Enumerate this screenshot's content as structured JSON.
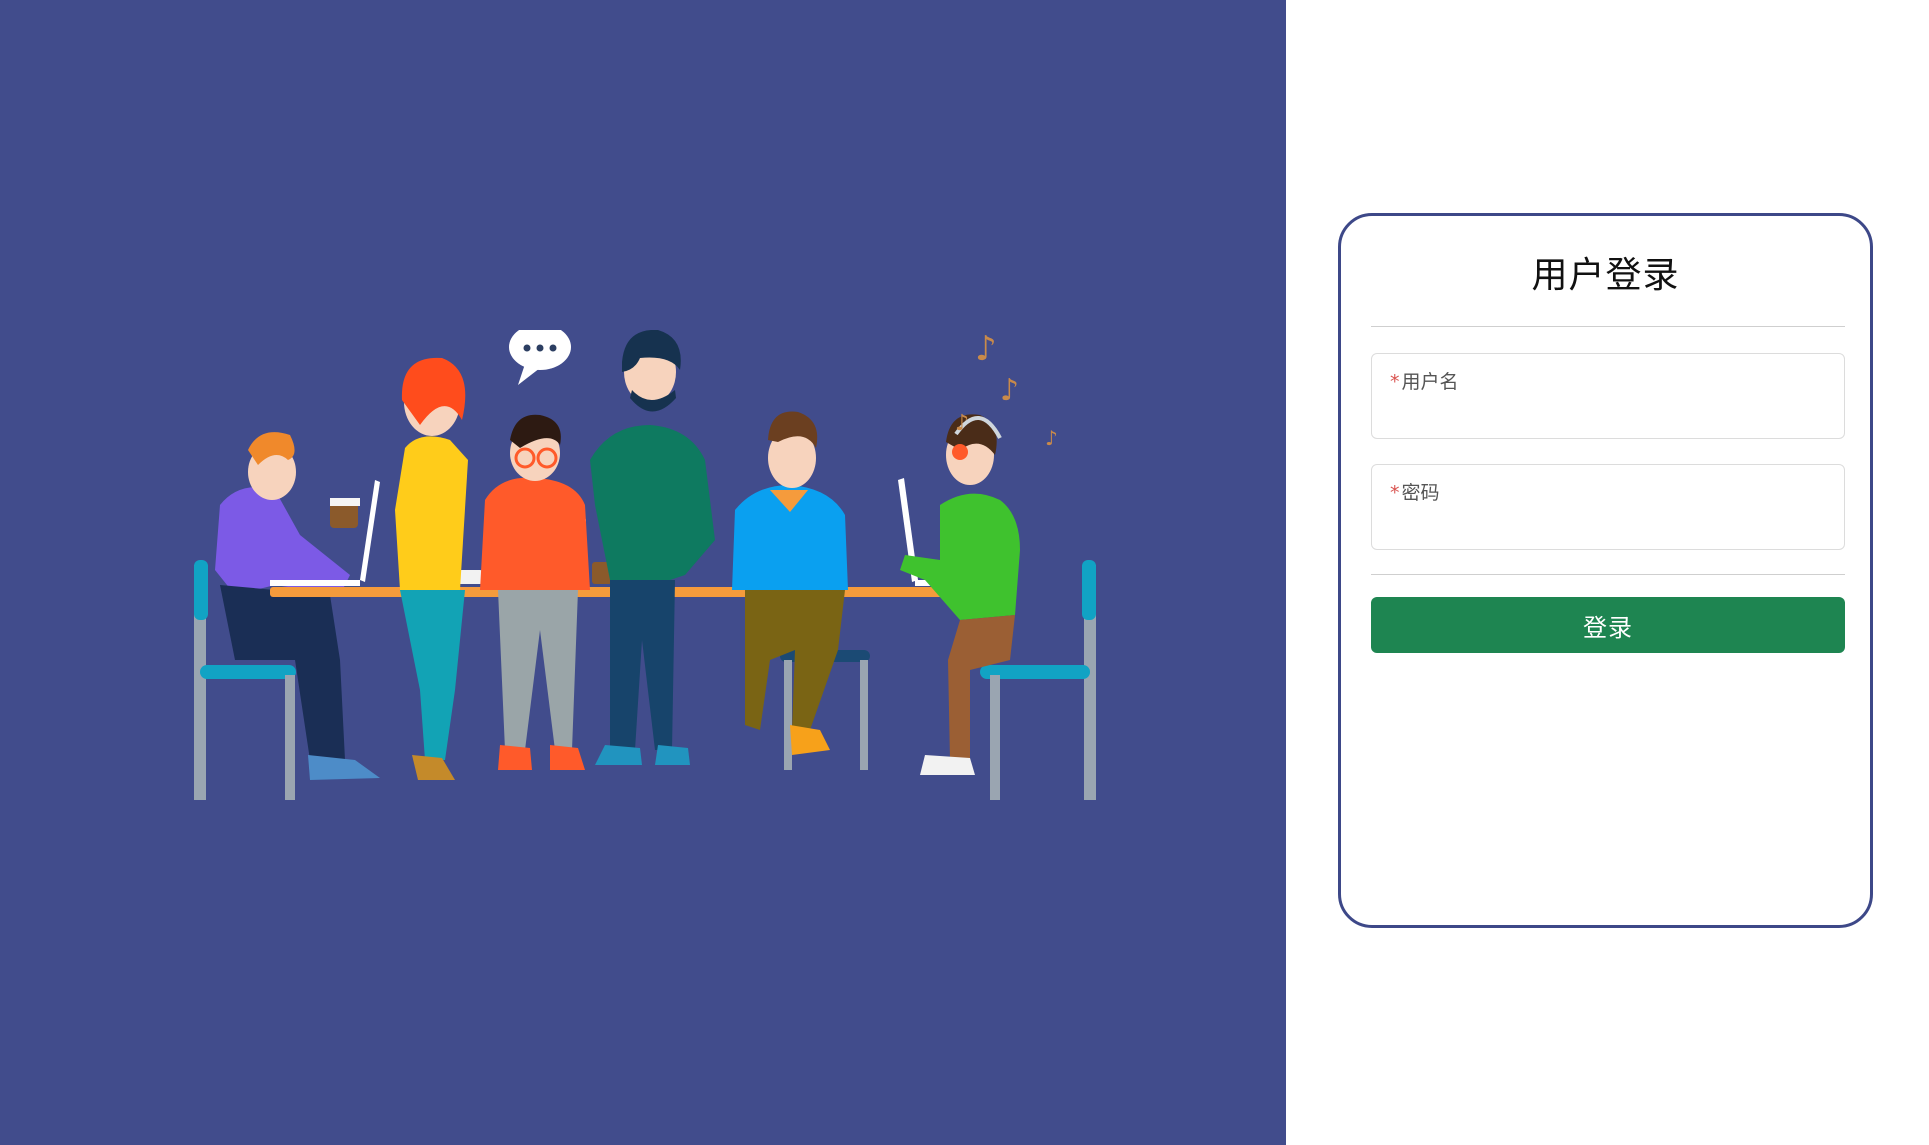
{
  "colors": {
    "left_background": "#414c8c",
    "card_border": "#3d4888",
    "button_background": "#1e8551",
    "required_marker": "#d9534f"
  },
  "login": {
    "title": "用户登录",
    "username": {
      "required_mark": "*",
      "label": "用户名",
      "value": ""
    },
    "password": {
      "required_mark": "*",
      "label": "密码",
      "value": ""
    },
    "submit_label": "登录"
  },
  "illustration": {
    "icon": "team-working-illustration",
    "speech_bubble_text": "..."
  }
}
